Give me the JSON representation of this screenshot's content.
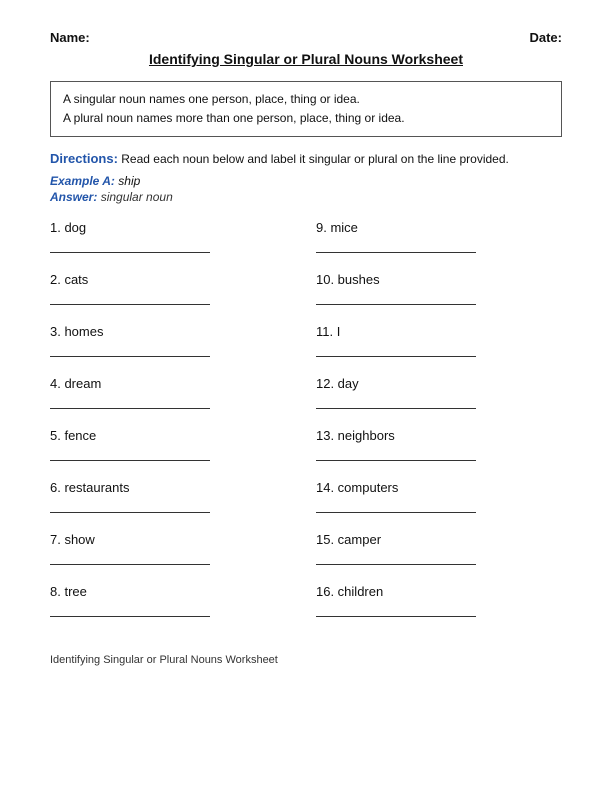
{
  "header": {
    "name_label": "Name:",
    "date_label": "Date:"
  },
  "title": "Identifying Singular or Plural Nouns Worksheet",
  "info": {
    "line1": "A singular noun names one person, place, thing or idea.",
    "line2": "A plural noun names more than one person, place, thing or idea."
  },
  "directions": {
    "label": "Directions:",
    "text": "Read each noun below and label it singular or plural on the line provided."
  },
  "example": {
    "label": "Example A:",
    "value": "ship",
    "answer_label": "Answer:",
    "answer_value": "singular noun"
  },
  "items": [
    {
      "num": "1.",
      "word": "dog"
    },
    {
      "num": "9.",
      "word": "mice"
    },
    {
      "num": "2.",
      "word": "cats"
    },
    {
      "num": "10.",
      "word": "bushes"
    },
    {
      "num": "3.",
      "word": "homes"
    },
    {
      "num": "11.",
      "word": "I"
    },
    {
      "num": "4.",
      "word": "dream"
    },
    {
      "num": "12.",
      "word": "day"
    },
    {
      "num": "5.",
      "word": "fence"
    },
    {
      "num": "13.",
      "word": "neighbors"
    },
    {
      "num": "6.",
      "word": "restaurants"
    },
    {
      "num": "14.",
      "word": "computers"
    },
    {
      "num": "7.",
      "word": "show"
    },
    {
      "num": "15.",
      "word": "camper"
    },
    {
      "num": "8.",
      "word": "tree"
    },
    {
      "num": "16.",
      "word": "children"
    }
  ],
  "footer": "Identifying Singular or Plural Nouns Worksheet"
}
